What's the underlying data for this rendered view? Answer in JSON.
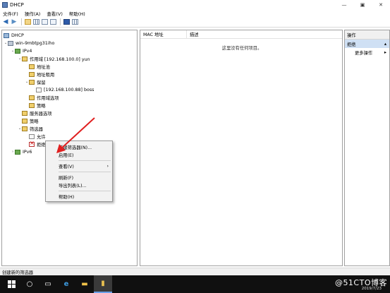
{
  "window": {
    "title": "DHCP",
    "minimize": "—",
    "restore": "▣",
    "close": "✕"
  },
  "menu": [
    "文件(F)",
    "操作(A)",
    "查看(V)",
    "帮助(H)"
  ],
  "tree": {
    "root": "DHCP",
    "server": "win-9mbtpg31iho",
    "ipv4": "IPv4",
    "scope": "作用域 [192.168.100.0] yun",
    "address_pool": "地址池",
    "address_leases": "地址租用",
    "reservations": "保留",
    "reservation_item": "[192.168.100.88] boss",
    "scope_options": "作用域选项",
    "scope_policies": "策略",
    "server_options": "服务器选项",
    "policies": "策略",
    "filters": "筛选器",
    "allow": "允许",
    "deny": "拒绝",
    "ipv6": "IPv6"
  },
  "list": {
    "col_mac": "MAC 地址",
    "col_desc": "描述",
    "empty_text": "这里没有任何项目。"
  },
  "actions_pane": {
    "header": "操作",
    "section": "拒绝",
    "more": "更多操作"
  },
  "context_menu": {
    "new_filter": "新建筛选器(N)...",
    "enable": "启用(E)",
    "view": "查看(V)",
    "refresh": "刷新(F)",
    "export_list": "导出列表(L)...",
    "help": "帮助(H)"
  },
  "status_bar": "创建新的筛选器",
  "tray": {
    "watermark": "@51CTO博客",
    "date": "2019/7/23"
  },
  "colors": {
    "accent": "#2d6ab3",
    "arrow": "#e02020",
    "selection": "#cfe0f4",
    "taskbar": "#101010"
  }
}
